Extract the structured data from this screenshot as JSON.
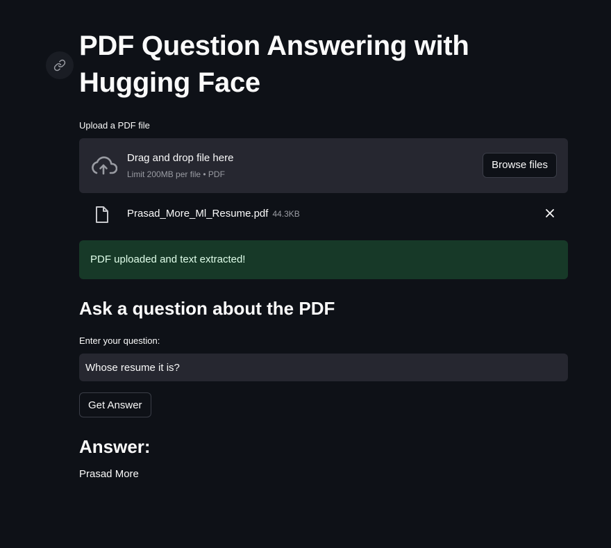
{
  "page": {
    "title_line1": "PDF Question Answering with",
    "title_line2": "Hugging Face"
  },
  "uploader": {
    "label": "Upload a PDF file",
    "drop_text": "Drag and drop file here",
    "limit_text": "Limit 200MB per file • PDF",
    "browse_label": "Browse files"
  },
  "uploaded_file": {
    "name": "Prasad_More_Ml_Resume.pdf",
    "size": "44.3KB"
  },
  "status": {
    "success_message": "PDF uploaded and text extracted!"
  },
  "question_section": {
    "heading": "Ask a question about the PDF",
    "input_label": "Enter your question:",
    "input_value": "Whose resume it is?",
    "button_label": "Get Answer"
  },
  "answer_section": {
    "heading": "Answer:",
    "text": "Prasad More"
  },
  "icons": {
    "anchor": "link-icon",
    "upload": "cloud-upload-icon",
    "file": "file-icon",
    "remove": "close-icon"
  },
  "colors": {
    "background": "#0e1117",
    "surface": "#262730",
    "success_bg": "#173928",
    "success_text": "#dffde9",
    "muted_text": "#9a9ca3"
  }
}
